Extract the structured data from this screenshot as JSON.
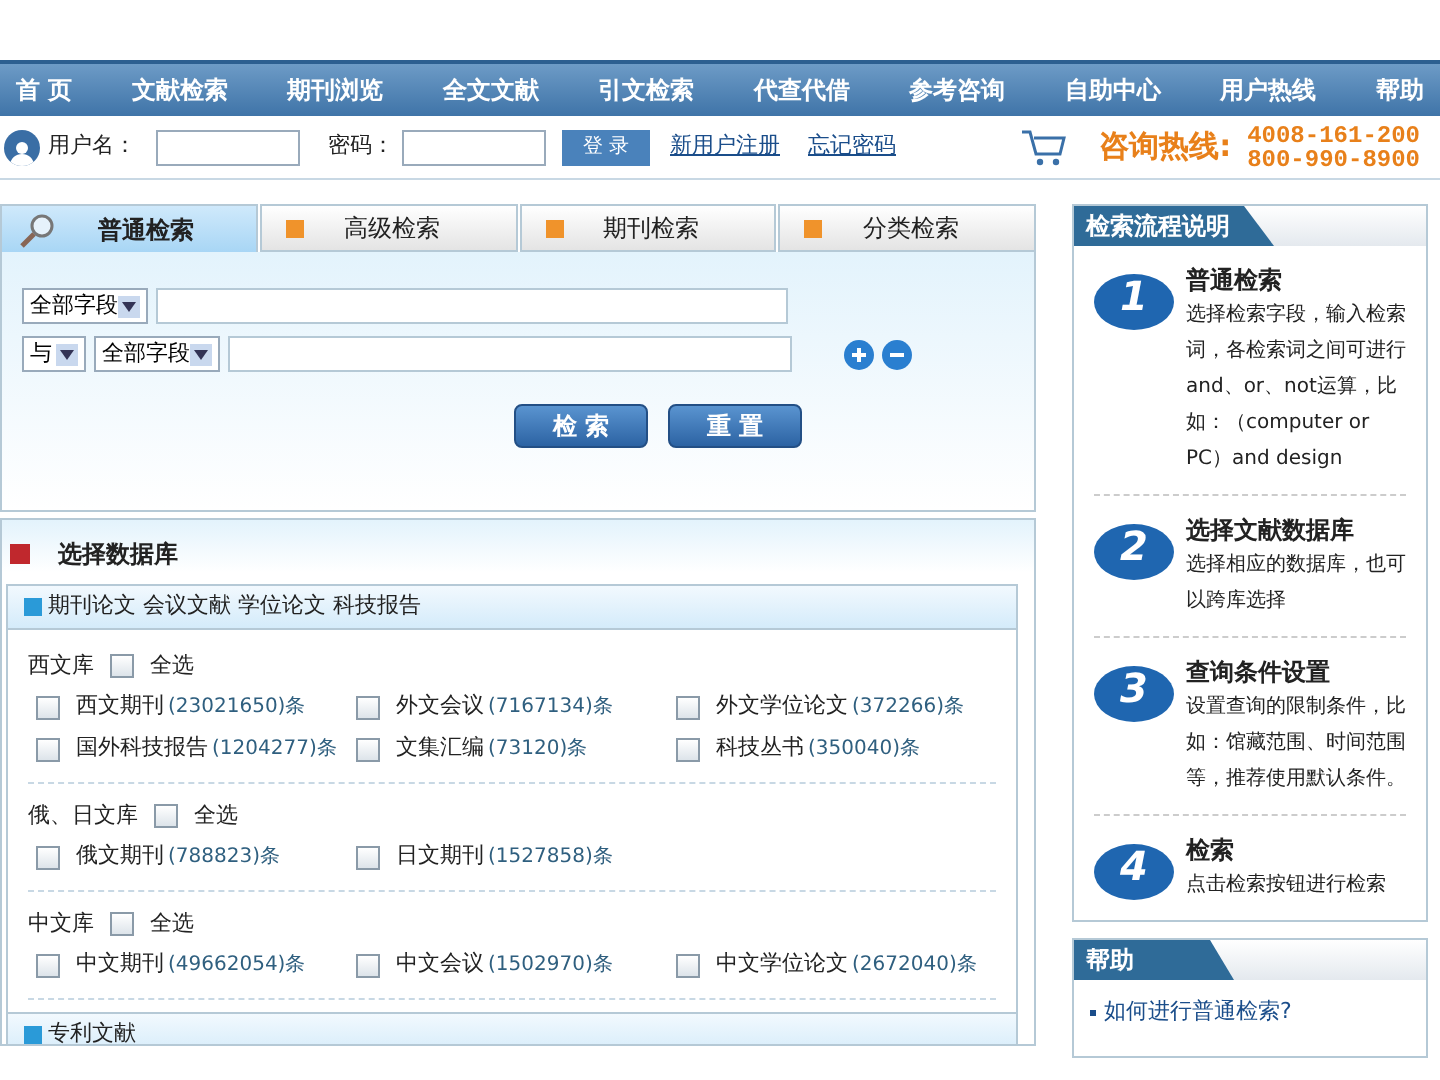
{
  "nav": [
    {
      "label": "首 页",
      "selected": false
    },
    {
      "label": "文献检索",
      "selected": false
    },
    {
      "label": "期刊浏览",
      "selected": false
    },
    {
      "label": "全文文献",
      "selected": false
    },
    {
      "label": "引文检索",
      "selected": false
    },
    {
      "label": "代查代借",
      "selected": false
    },
    {
      "label": "参考咨询",
      "selected": false
    },
    {
      "label": "自助中心",
      "selected": false
    },
    {
      "label": "用户热线",
      "selected": false
    },
    {
      "label": "帮助",
      "selected": false
    }
  ],
  "login": {
    "username_label": "用户名：",
    "password_label": "密码：",
    "login_button": "登 录",
    "register_link": "新用户注册",
    "forgot_link": "忘记密码",
    "hotline_label": "咨询热线:",
    "hotline_numbers": [
      "4008-161-200",
      "800-990-8900"
    ]
  },
  "tabs": [
    {
      "label": "普通检索",
      "selected": true
    },
    {
      "label": "高级检索",
      "selected": false
    },
    {
      "label": "期刊检索",
      "selected": false
    },
    {
      "label": "分类检索",
      "selected": false
    }
  ],
  "search": {
    "field_1": "全部字段",
    "operator": "与",
    "field_2": "全部字段",
    "buttons": [
      "检 索",
      "重 置"
    ]
  },
  "database": {
    "title": "选择数据库",
    "group_header": "期刊论文 会议文献 学位论文 科技报告",
    "libraries": [
      {
        "name": "西文库",
        "select_all": "全选",
        "checked": false,
        "items": [
          {
            "name": "西文期刊",
            "count": "(23021650)条",
            "checked": false
          },
          {
            "name": "外文会议",
            "count": "(7167134)条",
            "checked": false
          },
          {
            "name": "外文学位论文",
            "count": "(372266)条",
            "checked": false
          },
          {
            "name": "国外科技报告",
            "count": "(1204277)条",
            "checked": false
          },
          {
            "name": "文集汇编",
            "count": "(73120)条",
            "checked": false
          },
          {
            "name": "科技丛书",
            "count": "(350040)条",
            "checked": false
          }
        ]
      },
      {
        "name": "俄、日文库",
        "select_all": "全选",
        "checked": false,
        "items": [
          {
            "name": "俄文期刊",
            "count": "(788823)条",
            "checked": false
          },
          {
            "name": "日文期刊",
            "count": "(1527858)条",
            "checked": false
          }
        ]
      },
      {
        "name": "中文库",
        "select_all": "全选",
        "checked": false,
        "items": [
          {
            "name": "中文期刊",
            "count": "(49662054)条",
            "checked": false
          },
          {
            "name": "中文会议",
            "count": "(1502970)条",
            "checked": false
          },
          {
            "name": "中文学位论文",
            "count": "(2672040)条",
            "checked": false
          }
        ]
      }
    ],
    "next_group_header": "专利文献"
  },
  "guide": {
    "title": "检索流程说明",
    "steps": [
      {
        "number": "1",
        "title": "普通检索",
        "text": "选择检索字段，输入检索词，各检索词之间可进行and、or、not运算，比如：（computer or PC）and design"
      },
      {
        "number": "2",
        "title": "选择文献数据库",
        "text": "选择相应的数据库，也可以跨库选择"
      },
      {
        "number": "3",
        "title": "查询条件设置",
        "text": "设置查询的限制条件，比如：馆藏范围、时间范围等，推荐使用默认条件。"
      },
      {
        "number": "4",
        "title": "检索",
        "text": "点击检索按钮进行检索"
      }
    ]
  },
  "help": {
    "title": "帮助",
    "links": [
      "如何进行普通检索?"
    ]
  }
}
